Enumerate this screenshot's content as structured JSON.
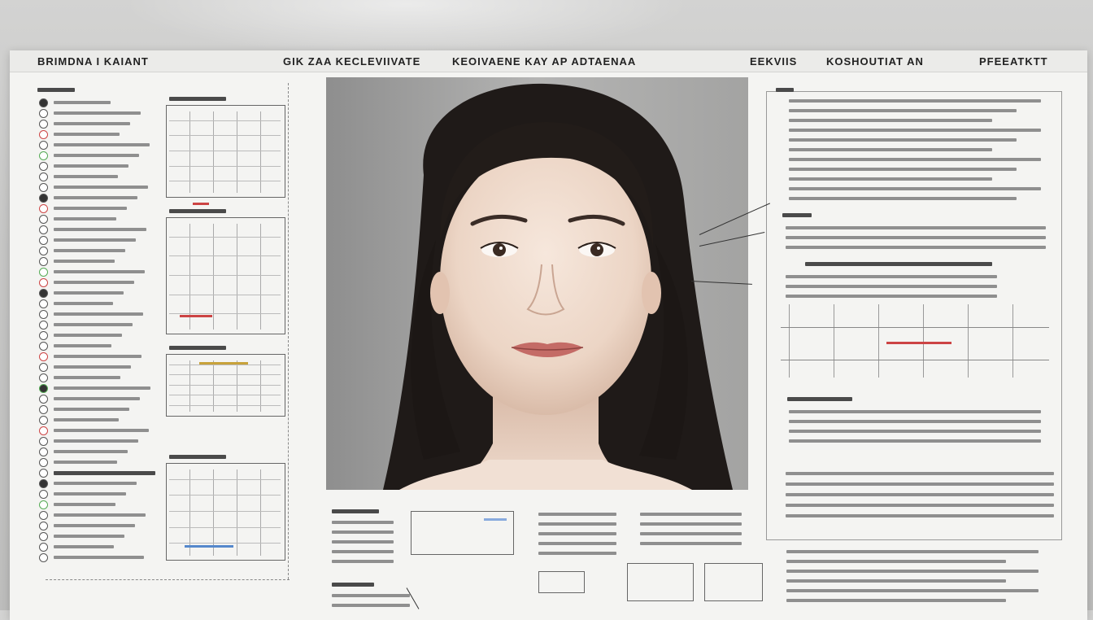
{
  "header": {
    "left_title": "BRIMDNA I KAIANT",
    "center_left": "GIK ZAA KECLEVIIVATE",
    "center_right": "KEOIVAENE KAY AP ADTAENAA",
    "right_1": "EEKVIIS",
    "right_2": "KOSHOUTIAT AN",
    "right_3": "PFEEATKTT"
  },
  "photo": {
    "subject": "portrait of a woman with long dark hair"
  },
  "colors": {
    "sheet": "#f4f4f2",
    "background": "#c6c6c5",
    "text": "#222222",
    "accent_red": "#cc4444",
    "accent_green": "#55aa55",
    "accent_blue": "#5588cc"
  },
  "icons": [
    "bullet-circle-icon",
    "photo-icon",
    "chart-icon",
    "callout-line-icon"
  ]
}
